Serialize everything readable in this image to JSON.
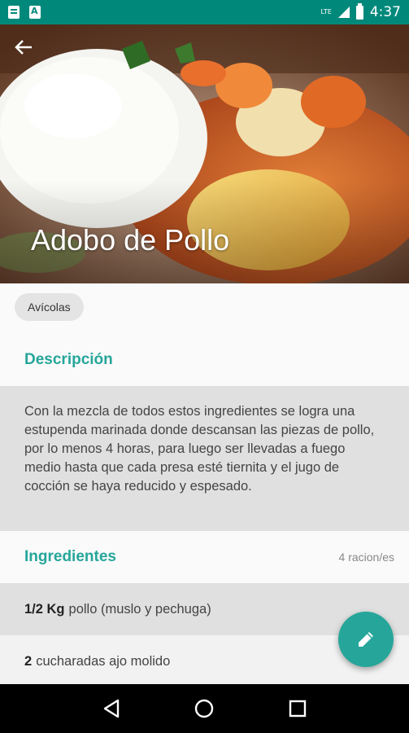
{
  "status_bar": {
    "time": "4:37",
    "left_icons": [
      "document-icon",
      "a-icon"
    ],
    "right_icons": [
      "lte-signal-icon",
      "battery-icon"
    ],
    "network_label": "LTE",
    "accent": "#00897b"
  },
  "header": {
    "title": "Adobo de Pollo",
    "back_icon": "arrow-back-icon"
  },
  "category_chip": "Avícolas",
  "description_section": {
    "title": "Descripción",
    "text": "Con la mezcla de todos estos ingredientes se logra una estupenda marinada donde descansan las piezas de pollo, por lo menos 4 horas, para luego ser llevadas a fuego medio hasta que cada presa esté tiernita y el jugo de cocción se haya reducido y espesado."
  },
  "ingredients_section": {
    "title": "Ingredientes",
    "servings": "4 racion/es",
    "items": [
      {
        "qty": "1/2 Kg",
        "name": "pollo (muslo y pechuga)"
      },
      {
        "qty": "2",
        "name": "cucharadas ajo molido"
      }
    ]
  },
  "fab": {
    "icon": "edit-icon",
    "color": "#26a69a"
  },
  "nav_bar": {
    "icons": [
      "back-triangle-icon",
      "home-circle-icon",
      "recents-square-icon"
    ]
  }
}
